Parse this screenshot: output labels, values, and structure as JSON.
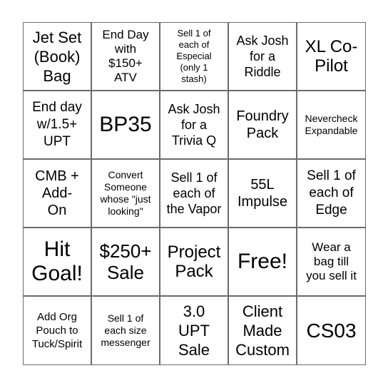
{
  "board": {
    "cells": [
      {
        "text": "Jet Set (Book) Bag",
        "lines": [
          "Jet Set",
          "(Book)",
          "Bag"
        ]
      },
      {
        "text": "End Day with $150+ ATV",
        "lines": [
          "End Day",
          "with",
          "$150+",
          "ATV"
        ]
      },
      {
        "text": "Sell 1 of each of Especial (only 1 stash)",
        "lines": [
          "Sell 1 of",
          "each of",
          "Especial",
          "(only 1",
          "stash)"
        ]
      },
      {
        "text": "Ask Josh for a Riddle",
        "lines": [
          "Ask Josh",
          "for a",
          "Riddle"
        ]
      },
      {
        "text": "XL Co-Pilot",
        "lines": [
          "XL Co-",
          "Pilot"
        ]
      },
      {
        "text": "End day w/1.5+ UPT",
        "lines": [
          "End day",
          "w/1.5+",
          "UPT"
        ]
      },
      {
        "text": "BP35",
        "lines": [
          "BP35"
        ]
      },
      {
        "text": "Ask Josh for a Trivia Q",
        "lines": [
          "Ask Josh",
          "for a",
          "Trivia Q"
        ]
      },
      {
        "text": "Foundry Pack",
        "lines": [
          "Foundry",
          "Pack"
        ]
      },
      {
        "text": "Nevercheck Expandable",
        "lines": [
          "Nevercheck",
          "Expandable"
        ]
      },
      {
        "text": "CMB + Add-On",
        "lines": [
          "CMB +",
          "Add-",
          "On"
        ]
      },
      {
        "text": "Convert Someone whose \"just looking\"",
        "lines": [
          "Convert",
          "Someone",
          "whose \"just",
          "looking\""
        ]
      },
      {
        "text": "Sell 1 of each of the Vapor",
        "lines": [
          "Sell 1 of",
          "each of",
          "the Vapor"
        ]
      },
      {
        "text": "55L Impulse",
        "lines": [
          "55L",
          "Impulse"
        ]
      },
      {
        "text": "Sell 1 of each of Edge",
        "lines": [
          "Sell 1 of",
          "each of",
          "Edge"
        ]
      },
      {
        "text": "Hit Goal!",
        "lines": [
          "Hit",
          "Goal!"
        ]
      },
      {
        "text": "$250+ Sale",
        "lines": [
          "$250+",
          "Sale"
        ]
      },
      {
        "text": "Project Pack",
        "lines": [
          "Project",
          "Pack"
        ]
      },
      {
        "text": "Free!",
        "lines": [
          "Free!"
        ],
        "free_space": true
      },
      {
        "text": "Wear a bag till you sell it",
        "lines": [
          "Wear a",
          "bag till",
          "you sell it"
        ]
      },
      {
        "text": "Add Org Pouch to Tuck/Spirit",
        "lines": [
          "Add Org",
          "Pouch to",
          "Tuck/Spirit"
        ]
      },
      {
        "text": "Sell 1 of each size messenger",
        "lines": [
          "Sell 1 of",
          "each size",
          "messenger"
        ]
      },
      {
        "text": "3.0 UPT Sale",
        "lines": [
          "3.0",
          "UPT",
          "Sale"
        ]
      },
      {
        "text": "Client Made Custom",
        "lines": [
          "Client",
          "Made",
          "Custom"
        ]
      },
      {
        "text": "CS03",
        "lines": [
          "CS03"
        ]
      }
    ]
  },
  "colors": {
    "grid_line": "#6b6b6b",
    "background": "#ffffff",
    "text": "#000000"
  }
}
